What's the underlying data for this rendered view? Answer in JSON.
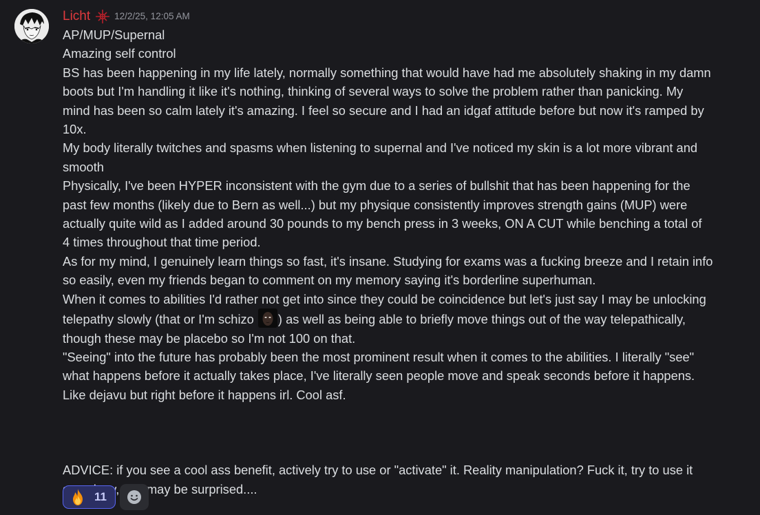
{
  "message": {
    "author": "Licht",
    "author_color": "#e03a3e",
    "role_icon": "red-cross-sigil-icon",
    "timestamp": "12/2/25, 12:05 AM",
    "lines": [
      "AP/MUP/Supernal",
      "Amazing self control",
      "BS has been happening in my life lately, normally something that would have had me absolutely shaking in my damn",
      "boots but I'm handling it like it's nothing, thinking of several ways to solve the problem rather than panicking. My",
      "mind has been so calm lately it's amazing. I feel so secure and I had an idgaf attitude before but now it's ramped by",
      "10x.",
      "My body literally twitches and spasms when listening to supernal and I've noticed my skin is a lot more vibrant and",
      "smooth",
      "Physically, I've been HYPER inconsistent with the gym due to a series of bullshit that has been happening for the",
      "past few months (likely due to Bern as well...) but my physique consistently improves strength gains (MUP) were",
      "actually quite wild as I added around 30 pounds to my bench press in 3 weeks, ON A CUT while benching a total of",
      "4 times throughout that time period.",
      "As for my mind, I genuinely learn things so fast, it's insane. Studying for exams was a fucking breeze and I retain info",
      "so easily, even my friends began to comment on my memory saying it's borderline superhuman.",
      "When it comes to abilities I'd rather not get into since they could be coincidence but let's just say I may be unlocking"
    ],
    "telepathy_line_before": "telepathy slowly (that or I'm schizo ",
    "telepathy_line_after": ") as well as being able to briefly move things out of the way telepathically,",
    "inline_emoji": "dark-face-emoji",
    "lines_after": [
      "though these may be placebo so I'm not 100 on that.",
      "\"Seeing\" into the future has probably been the most prominent result when it comes to the abilities. I literally \"see\"",
      "what happens before it actually takes place, I've literally seen people move and speak seconds before it happens.",
      "Like dejavu but right before it happens irl. Cool asf."
    ],
    "advice_lines": [
      "ADVICE: if you see a cool ass benefit, actively try to use or \"activate\" it. Reality manipulation? Fuck it, try to use it",
      "somehow, you may be surprised...."
    ]
  },
  "reactions": [
    {
      "emoji": "fire-icon",
      "count": "11",
      "selected": true
    }
  ],
  "add_reaction_icon": "add-reaction-smiley-icon"
}
